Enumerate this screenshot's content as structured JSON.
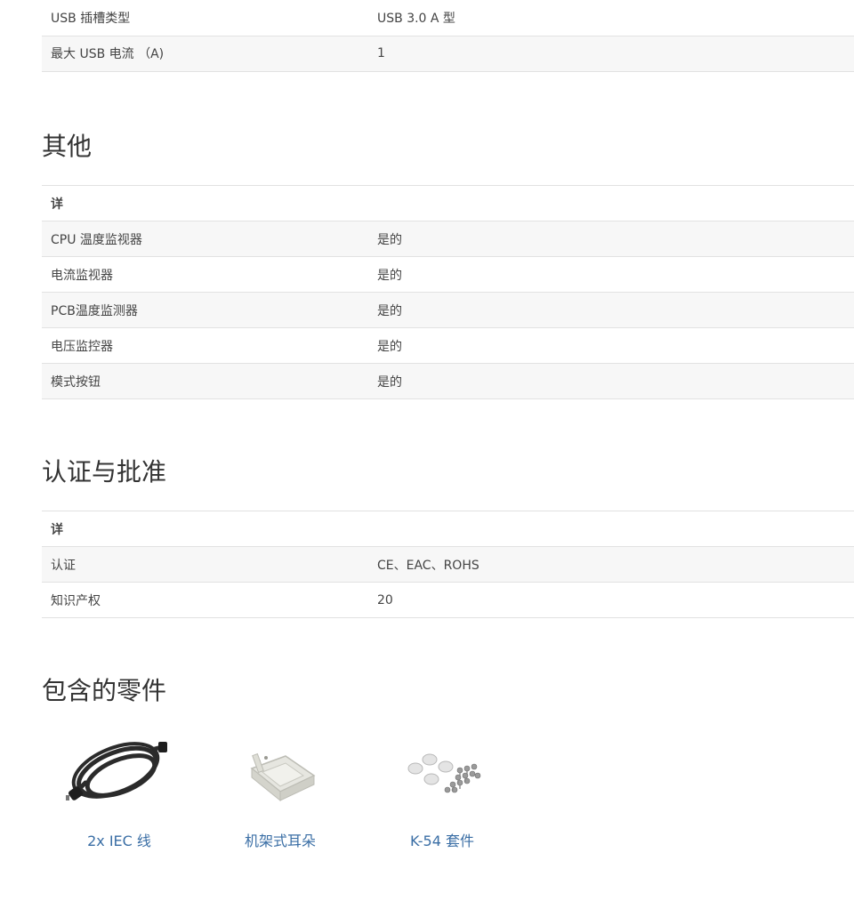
{
  "usb_table": {
    "rows": [
      {
        "label": "USB 插槽类型",
        "value": "USB 3.0 A 型"
      },
      {
        "label": "最大 USB 电流 （A)",
        "value": "1"
      }
    ]
  },
  "other": {
    "title": "其他",
    "header": "详",
    "rows": [
      {
        "label": "CPU 温度监视器",
        "value": "是的"
      },
      {
        "label": "电流监视器",
        "value": "是的"
      },
      {
        "label": "PCB温度监测器",
        "value": "是的"
      },
      {
        "label": "电压监控器",
        "value": "是的"
      },
      {
        "label": "模式按钮",
        "value": "是的"
      }
    ]
  },
  "cert": {
    "title": "认证与批准",
    "header": "详",
    "rows": [
      {
        "label": "认证",
        "value": "CE、EAC、ROHS"
      },
      {
        "label": "知识产权",
        "value": "20"
      }
    ]
  },
  "parts": {
    "title": "包含的零件",
    "items": [
      {
        "label": "2x IEC 线",
        "icon": "power-cable-icon"
      },
      {
        "label": "机架式耳朵",
        "icon": "rack-ears-icon"
      },
      {
        "label": "K-54 套件",
        "icon": "screw-kit-icon"
      }
    ],
    "link_color": "#3a6ea5"
  }
}
